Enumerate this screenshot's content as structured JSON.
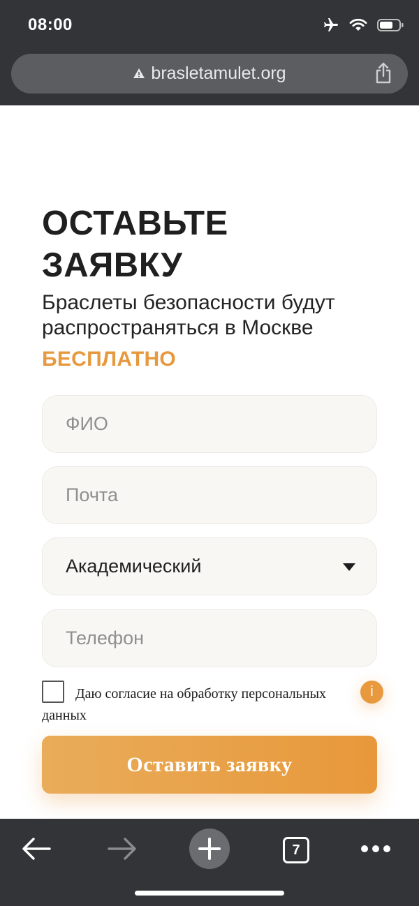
{
  "status_bar": {
    "time": "08:00",
    "icons": [
      "airplane-icon",
      "wifi-icon",
      "battery-icon"
    ]
  },
  "browser": {
    "url": "brasletamulet.org",
    "url_icon": "warning-icon",
    "share_icon": "share-icon"
  },
  "form": {
    "heading": "ОСТАВЬТЕ ЗАЯВКУ",
    "subtitle": "Браслеты безопасности будут распространяться в Москве",
    "highlight": "БЕСПЛАТНО",
    "name_placeholder": "ФИО",
    "email_placeholder": "Почта",
    "district_selected": "Академический",
    "phone_placeholder": "Телефон",
    "consent_label": "Даю согласие на обработку персональных данных",
    "consent_checked": false,
    "info_badge": "i",
    "submit_label": "Оставить заявку"
  },
  "colors": {
    "accent": "#e8993e",
    "chrome": "#333438",
    "field_bg": "#f8f7f3"
  },
  "toolbar": {
    "back_icon": "back-arrow-icon",
    "forward_icon": "forward-arrow-icon",
    "new_tab_icon": "plus-icon",
    "tab_count": "7",
    "more_icon": "more-icon"
  }
}
